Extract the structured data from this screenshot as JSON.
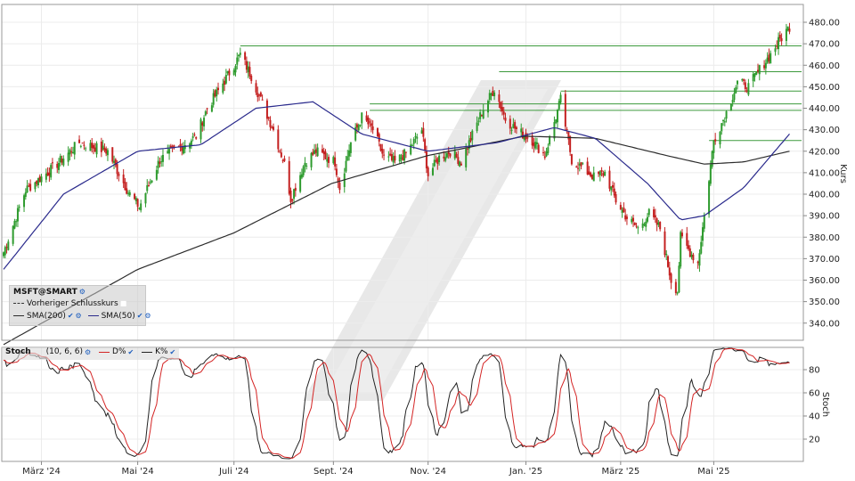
{
  "chart_data": [
    {
      "type": "candlestick",
      "symbol": "MSFT@SMART",
      "ylabel": "Kurs",
      "ylim": [
        330,
        485
      ],
      "y_ticks": [
        "480.00",
        "470.00",
        "460.00",
        "450.00",
        "440.00",
        "430.00",
        "420.00",
        "410.00",
        "400.00",
        "390.00",
        "380.00",
        "370.00",
        "360.00",
        "350.00",
        "340.00"
      ],
      "x_ticks": [
        "März '24",
        "Mai '24",
        "Juli '24",
        "Sept. '24",
        "Nov. '24",
        "Jan. '25",
        "März '25",
        "Mai '25"
      ],
      "legend": {
        "title": "MSFT@SMART",
        "items": [
          {
            "label": "Vorheriger Schlusskurs",
            "style": "dashed",
            "color": "#333333"
          },
          {
            "label": "SMA(200)",
            "color": "#2b2b2b"
          },
          {
            "label": "SMA(50)",
            "color": "#2a2a8c"
          }
        ]
      },
      "anchors": [
        [
          "2024-02-06",
          373
        ],
        [
          "2024-02-20",
          402
        ],
        [
          "2024-03-08",
          412
        ],
        [
          "2024-03-25",
          424
        ],
        [
          "2024-04-12",
          420
        ],
        [
          "2024-04-25",
          401
        ],
        [
          "2024-05-02",
          394
        ],
        [
          "2024-05-15",
          416
        ],
        [
          "2024-05-28",
          422
        ],
        [
          "2024-06-07",
          427
        ],
        [
          "2024-06-14",
          440
        ],
        [
          "2024-06-21",
          448
        ],
        [
          "2024-07-05",
          465
        ],
        [
          "2024-07-12",
          455
        ],
        [
          "2024-07-19",
          442
        ],
        [
          "2024-07-26",
          430
        ],
        [
          "2024-08-02",
          414
        ],
        [
          "2024-08-06",
          398
        ],
        [
          "2024-08-15",
          415
        ],
        [
          "2024-08-22",
          420
        ],
        [
          "2024-09-03",
          415
        ],
        [
          "2024-09-06",
          403
        ],
        [
          "2024-09-13",
          424
        ],
        [
          "2024-09-20",
          436
        ],
        [
          "2024-09-27",
          430
        ],
        [
          "2024-10-04",
          417
        ],
        [
          "2024-10-11",
          415
        ],
        [
          "2024-10-18",
          419
        ],
        [
          "2024-10-28",
          430
        ],
        [
          "2024-11-01",
          409
        ],
        [
          "2024-11-08",
          417
        ],
        [
          "2024-11-15",
          420
        ],
        [
          "2024-11-22",
          415
        ],
        [
          "2024-12-06",
          440
        ],
        [
          "2024-12-13",
          449
        ],
        [
          "2024-12-20",
          435
        ],
        [
          "2024-12-27",
          430
        ],
        [
          "2025-01-06",
          425
        ],
        [
          "2025-01-14",
          418
        ],
        [
          "2025-01-24",
          444
        ],
        [
          "2025-01-31",
          416
        ],
        [
          "2025-02-07",
          412
        ],
        [
          "2025-02-14",
          408
        ],
        [
          "2025-02-21",
          410
        ],
        [
          "2025-02-28",
          397
        ],
        [
          "2025-03-07",
          389
        ],
        [
          "2025-03-14",
          384
        ],
        [
          "2025-03-21",
          391
        ],
        [
          "2025-03-28",
          384
        ],
        [
          "2025-04-04",
          360
        ],
        [
          "2025-04-08",
          355
        ],
        [
          "2025-04-10",
          380
        ],
        [
          "2025-04-17",
          372
        ],
        [
          "2025-04-21",
          368
        ],
        [
          "2025-04-25",
          390
        ],
        [
          "2025-05-01",
          425
        ],
        [
          "2025-05-09",
          438
        ],
        [
          "2025-05-16",
          452
        ],
        [
          "2025-05-23",
          450
        ],
        [
          "2025-05-30",
          458
        ],
        [
          "2025-06-06",
          465
        ],
        [
          "2025-06-12",
          472
        ],
        [
          "2025-06-18",
          478
        ]
      ],
      "sma200_anchors": [
        [
          "2024-02-06",
          330
        ],
        [
          "2024-05-01",
          365
        ],
        [
          "2024-07-01",
          382
        ],
        [
          "2024-09-01",
          405
        ],
        [
          "2024-11-01",
          418
        ],
        [
          "2025-01-01",
          427
        ],
        [
          "2025-02-15",
          426
        ],
        [
          "2025-04-01",
          418
        ],
        [
          "2025-04-25",
          414
        ],
        [
          "2025-05-20",
          415
        ],
        [
          "2025-06-18",
          420
        ]
      ],
      "sma50_anchors": [
        [
          "2024-02-06",
          365
        ],
        [
          "2024-03-15",
          400
        ],
        [
          "2024-05-01",
          420
        ],
        [
          "2024-06-10",
          423
        ],
        [
          "2024-07-15",
          440
        ],
        [
          "2024-08-20",
          443
        ],
        [
          "2024-09-20",
          428
        ],
        [
          "2024-11-01",
          420
        ],
        [
          "2024-12-15",
          424
        ],
        [
          "2025-01-20",
          431
        ],
        [
          "2025-02-15",
          426
        ],
        [
          "2025-03-20",
          405
        ],
        [
          "2025-04-10",
          388
        ],
        [
          "2025-04-25",
          390
        ],
        [
          "2025-05-20",
          403
        ],
        [
          "2025-06-18",
          428
        ]
      ],
      "support_resistance_lines": [
        {
          "y": 469,
          "from": "2024-07-05",
          "to": "2025-06-20",
          "color": "#3d9a3d"
        },
        {
          "y": 457,
          "from": "2024-12-16",
          "to": "2025-06-20",
          "color": "#3d9a3d"
        },
        {
          "y": 448,
          "from": "2025-01-24",
          "to": "2025-06-20",
          "color": "#3d9a3d"
        },
        {
          "y": 442,
          "from": "2024-09-25",
          "to": "2025-06-20",
          "color": "#3d9a3d"
        },
        {
          "y": 439,
          "from": "2024-09-25",
          "to": "2025-06-20",
          "color": "#3d9a3d"
        },
        {
          "y": 425,
          "from": "2025-04-28",
          "to": "2025-06-20",
          "color": "#3d9a3d"
        }
      ],
      "colors": {
        "up": "#2e9b2e",
        "down": "#c42020",
        "sma200": "#2b2b2b",
        "sma50": "#2a2a8c"
      }
    },
    {
      "type": "line",
      "title": "Stoch",
      "params": "(10, 6, 6)",
      "ylabel": "Stoch",
      "ylim": [
        0,
        100
      ],
      "y_ticks": [
        "80",
        "60",
        "40",
        "20"
      ],
      "series": [
        {
          "name": "D%",
          "color": "#d42424"
        },
        {
          "name": "K%",
          "color": "#222222"
        }
      ]
    }
  ],
  "stoch_legend": {
    "title": "Stoch",
    "params": "(10, 6, 6)",
    "d_label": "D%",
    "k_label": "K%"
  }
}
